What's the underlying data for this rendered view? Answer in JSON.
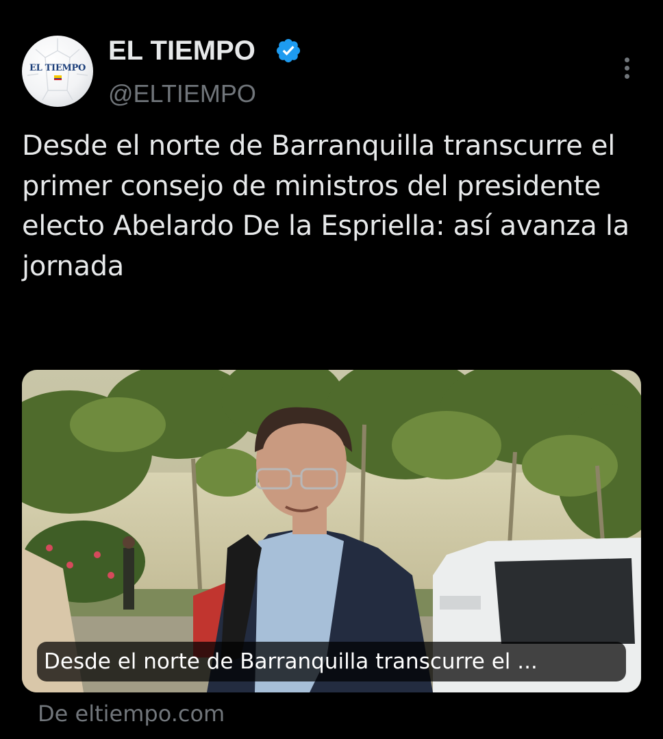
{
  "account": {
    "display_name": "EL TIEMPO",
    "handle": "@ELTIEMPO",
    "verified": true,
    "avatar_logo_text": "EL TIEMPO",
    "avatar_icon": "newspaper-logo-on-soccer-ball"
  },
  "icons": {
    "verified": "verified-badge-icon",
    "more": "more-options-icon"
  },
  "tweet": {
    "text": "Desde el norte de Barranquilla transcurre el primer consejo de ministros del presidente electo Abelardo De la Espriella: así avanza la jornada"
  },
  "link_card": {
    "image_description_icon": "photo",
    "caption": "Desde el norte de Barranquilla transcurre el ...",
    "source": "De eltiempo.com"
  },
  "colors": {
    "background": "#000000",
    "primary_text": "#e7e9ea",
    "secondary_text": "#71767b",
    "verified_blue": "#1d9bf0"
  }
}
